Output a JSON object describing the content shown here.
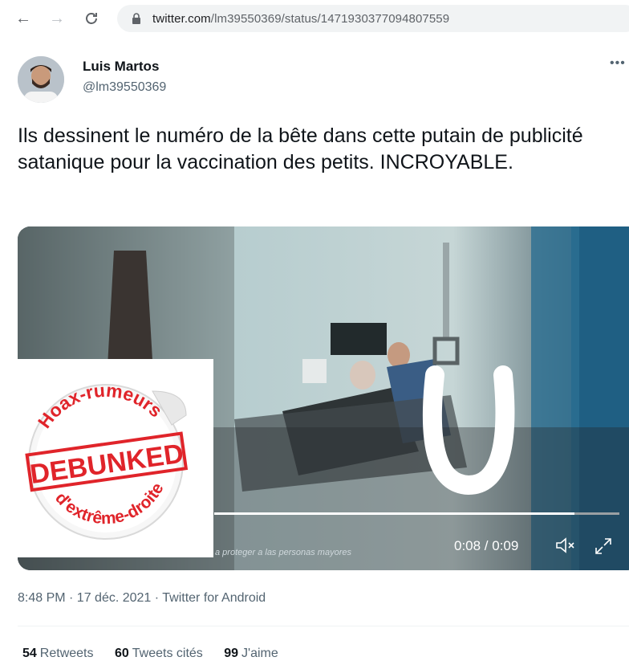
{
  "browser": {
    "url_domain": "twitter.com",
    "url_path": "/lm39550369/status/1471930377094807559"
  },
  "tweet": {
    "author_name": "Luis Martos",
    "author_handle": "@lm39550369",
    "text": "Ils dessinent le numéro de la bête dans cette putain de publicité satanique pour la vaccination des petits. INCROYABLE.",
    "timestamp": "8:48 PM · 17 déc. 2021 · Twitter for Android",
    "stats": {
      "retweets_count": "54",
      "retweets_label": "Retweets",
      "quotes_count": "60",
      "quotes_label": "Tweets cités",
      "likes_count": "99",
      "likes_label": "J'aime"
    }
  },
  "video": {
    "time_display": "0:08 / 0:09",
    "subtitle": "a proteger a las personas mayores",
    "progress": 0.89
  },
  "sticker": {
    "top_text": "Hoax-rumeurs",
    "center_text": "DEBUNKED",
    "bottom_text": "d'extrême-droite"
  },
  "colors": {
    "text": "#0f1419",
    "secondary": "#536471",
    "stamp_red": "#e0242a"
  }
}
